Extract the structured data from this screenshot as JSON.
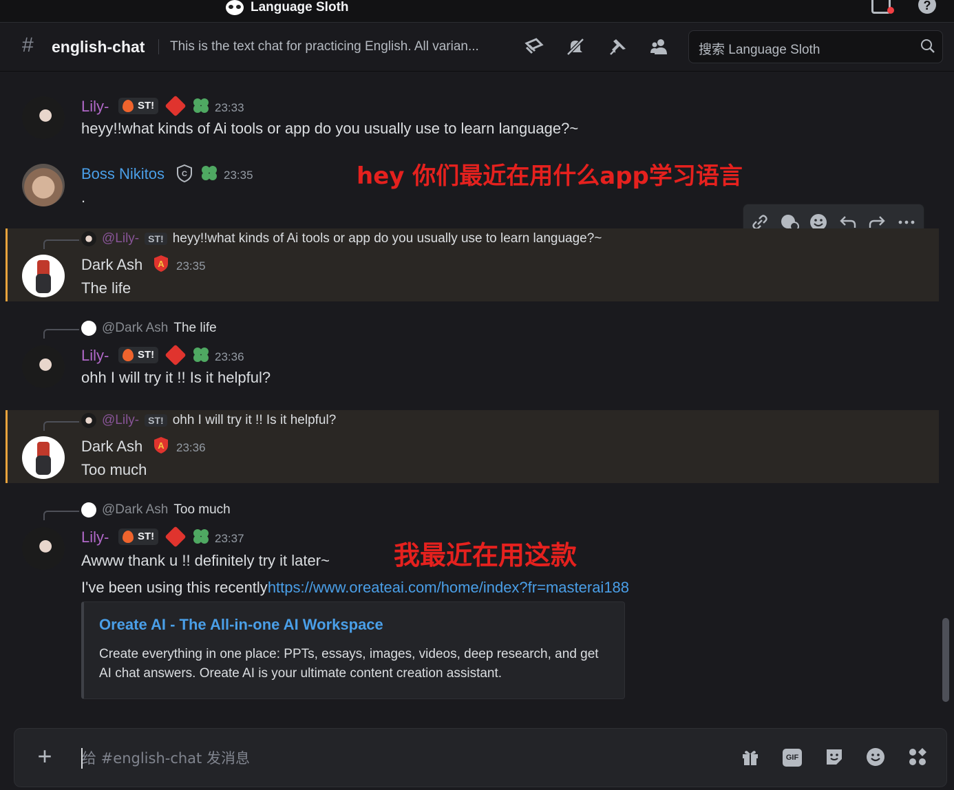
{
  "app": {
    "server_name": "Language Sloth"
  },
  "header": {
    "hash": "#",
    "channel": "english-chat",
    "topic": "This is the text chat for practicing English. All varian...",
    "search_placeholder": "搜索 Language Sloth"
  },
  "messages": [
    {
      "author": "Lily-",
      "tag": "ST!",
      "time": "23:33",
      "text": "heyy!!what kinds of Ai tools or app do you usually use to learn language?~"
    },
    {
      "author": "Boss Nikitos",
      "time": "23:35",
      "text": "."
    },
    {
      "reply_to": "@Lily-",
      "reply_tag": "ST!",
      "reply_text": "heyy!!what kinds of Ai tools or app do you usually use to learn language?~",
      "author": "Dark Ash",
      "time": "23:35",
      "text": "The life"
    },
    {
      "reply_to": "@Dark Ash",
      "reply_text": "The life",
      "author": "Lily-",
      "tag": "ST!",
      "time": "23:36",
      "text": "ohh I will try it !! Is it helpful?"
    },
    {
      "reply_to": "@Lily-",
      "reply_tag": "ST!",
      "reply_text": "ohh I will try it !! Is it helpful?",
      "author": "Dark Ash",
      "time": "23:36",
      "text": "Too much"
    },
    {
      "reply_to": "@Dark Ash",
      "reply_text": "Too much",
      "author": "Lily-",
      "tag": "ST!",
      "time": "23:37",
      "text": "Awww thank u !! definitely try it later~",
      "text2_prefix": "I've been using this recently",
      "link": "https://www.oreateai.com/home/index?fr=masterai188"
    }
  ],
  "embed": {
    "title": "Oreate AI - The All-in-one AI Workspace",
    "description": "Create everything in one place: PPTs, essays, images, videos, deep research, and get AI chat answers. Oreate AI is your ultimate content creation assistant."
  },
  "annotations": {
    "a1": "hey 你们最近在用什么app学习语言",
    "a2": "我最近在用这款"
  },
  "composer": {
    "placeholder": "给 #english-chat 发消息"
  },
  "colors": {
    "lily": "#b168c9",
    "boss": "#4a9fe8",
    "link": "#4a9fe8",
    "annotation": "#e5211e",
    "highlight_bar": "#e9a33c"
  }
}
